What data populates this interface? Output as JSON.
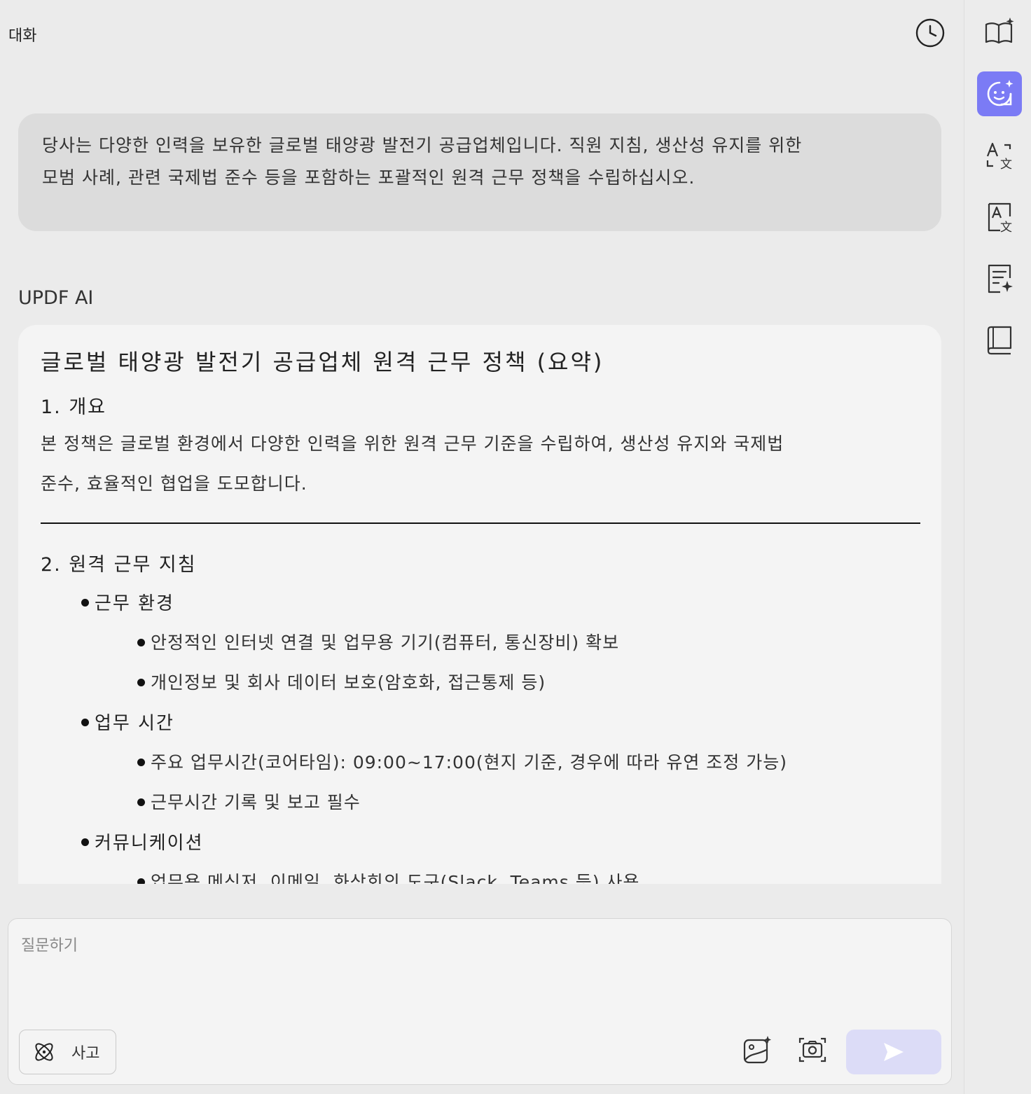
{
  "header": {
    "title": "대화"
  },
  "conversation": {
    "user_message_line1": "당사는 다양한 인력을 보유한 글로벌 태양광 발전기 공급업체입니다. 직원 지침, 생산성 유지를 위한",
    "user_message_line2": "모범 사례, 관련 국제법 준수 등을 포함하는 포괄적인 원격 근무 정책을 수립하십시오.",
    "ai_label": "UPDF AI",
    "response": {
      "title": "글로벌 태양광 발전기 공급업체 원격 근무 정책 (요약)",
      "s1_heading": "1. 개요",
      "s1_line1": "본 정책은 글로벌 환경에서 다양한 인력을 위한 원격 근무 기준을 수립하여, 생산성 유지와 국제법",
      "s1_line2": "준수, 효율적인 협업을 도모합니다.",
      "s2_heading": "2. 원격 근무 지침",
      "bullets": [
        {
          "label": "근무 환경",
          "items": [
            "안정적인 인터넷 연결 및 업무용 기기(컴퓨터, 통신장비) 확보",
            "개인정보 및 회사 데이터 보호(암호화, 접근통제 등)"
          ]
        },
        {
          "label": "업무 시간",
          "items": [
            "주요 업무시간(코어타임): 09:00~17:00(현지 기준, 경우에 따라 유연 조정 가능)",
            "근무시간 기록 및 보고 필수"
          ]
        },
        {
          "label": "커뮤니케이션",
          "items": [
            "업무용 메신저, 이메일, 화상회의 도구(Slack, Teams 등) 사용"
          ]
        }
      ]
    }
  },
  "input": {
    "placeholder": "질문하기",
    "think_label": "사고"
  },
  "sidebar": {
    "items": [
      {
        "icon": "book-sparkle-icon",
        "active": false
      },
      {
        "icon": "ai-chat-icon",
        "active": true
      },
      {
        "icon": "translate-icon",
        "active": false
      },
      {
        "icon": "translate-doc-icon",
        "active": false
      },
      {
        "icon": "summarize-icon",
        "active": false
      },
      {
        "icon": "book-icon",
        "active": false
      }
    ]
  },
  "colors": {
    "accent": "#7b7bf5",
    "send_disabled": "#dcdcf7"
  }
}
